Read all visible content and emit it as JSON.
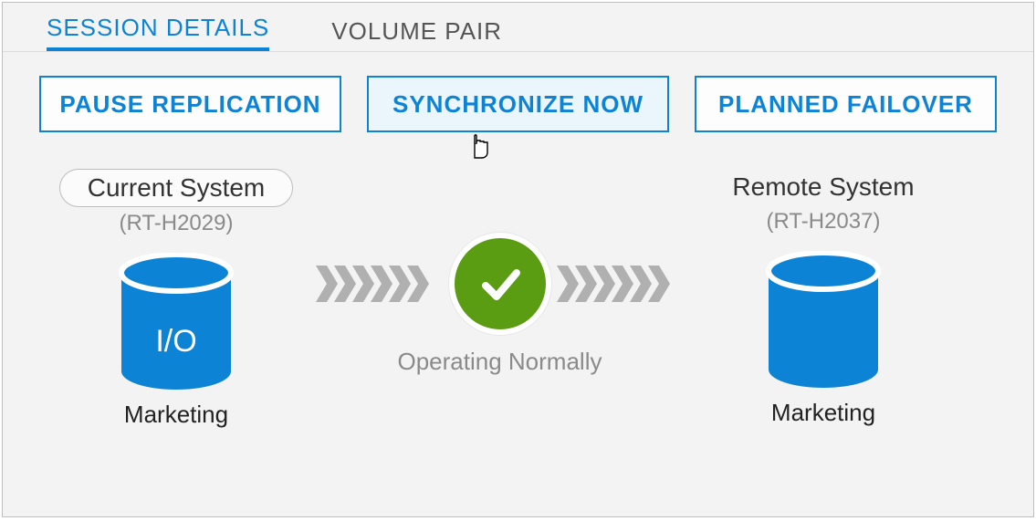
{
  "tabs": {
    "session_details": "SESSION DETAILS",
    "volume_pair": "VOLUME PAIR"
  },
  "actions": {
    "pause": "PAUSE REPLICATION",
    "sync": "SYNCHRONIZE NOW",
    "failover": "PLANNED FAILOVER"
  },
  "current_system": {
    "label": "Current System",
    "id": "(RT-H2029)",
    "io": "I/O",
    "volume": "Marketing"
  },
  "remote_system": {
    "label": "Remote System",
    "id": "(RT-H2037)",
    "volume": "Marketing"
  },
  "status": {
    "text": "Operating Normally"
  },
  "colors": {
    "accent": "#0d83d6",
    "ok": "#5a9c12",
    "chevron": "#b0b0b0"
  }
}
